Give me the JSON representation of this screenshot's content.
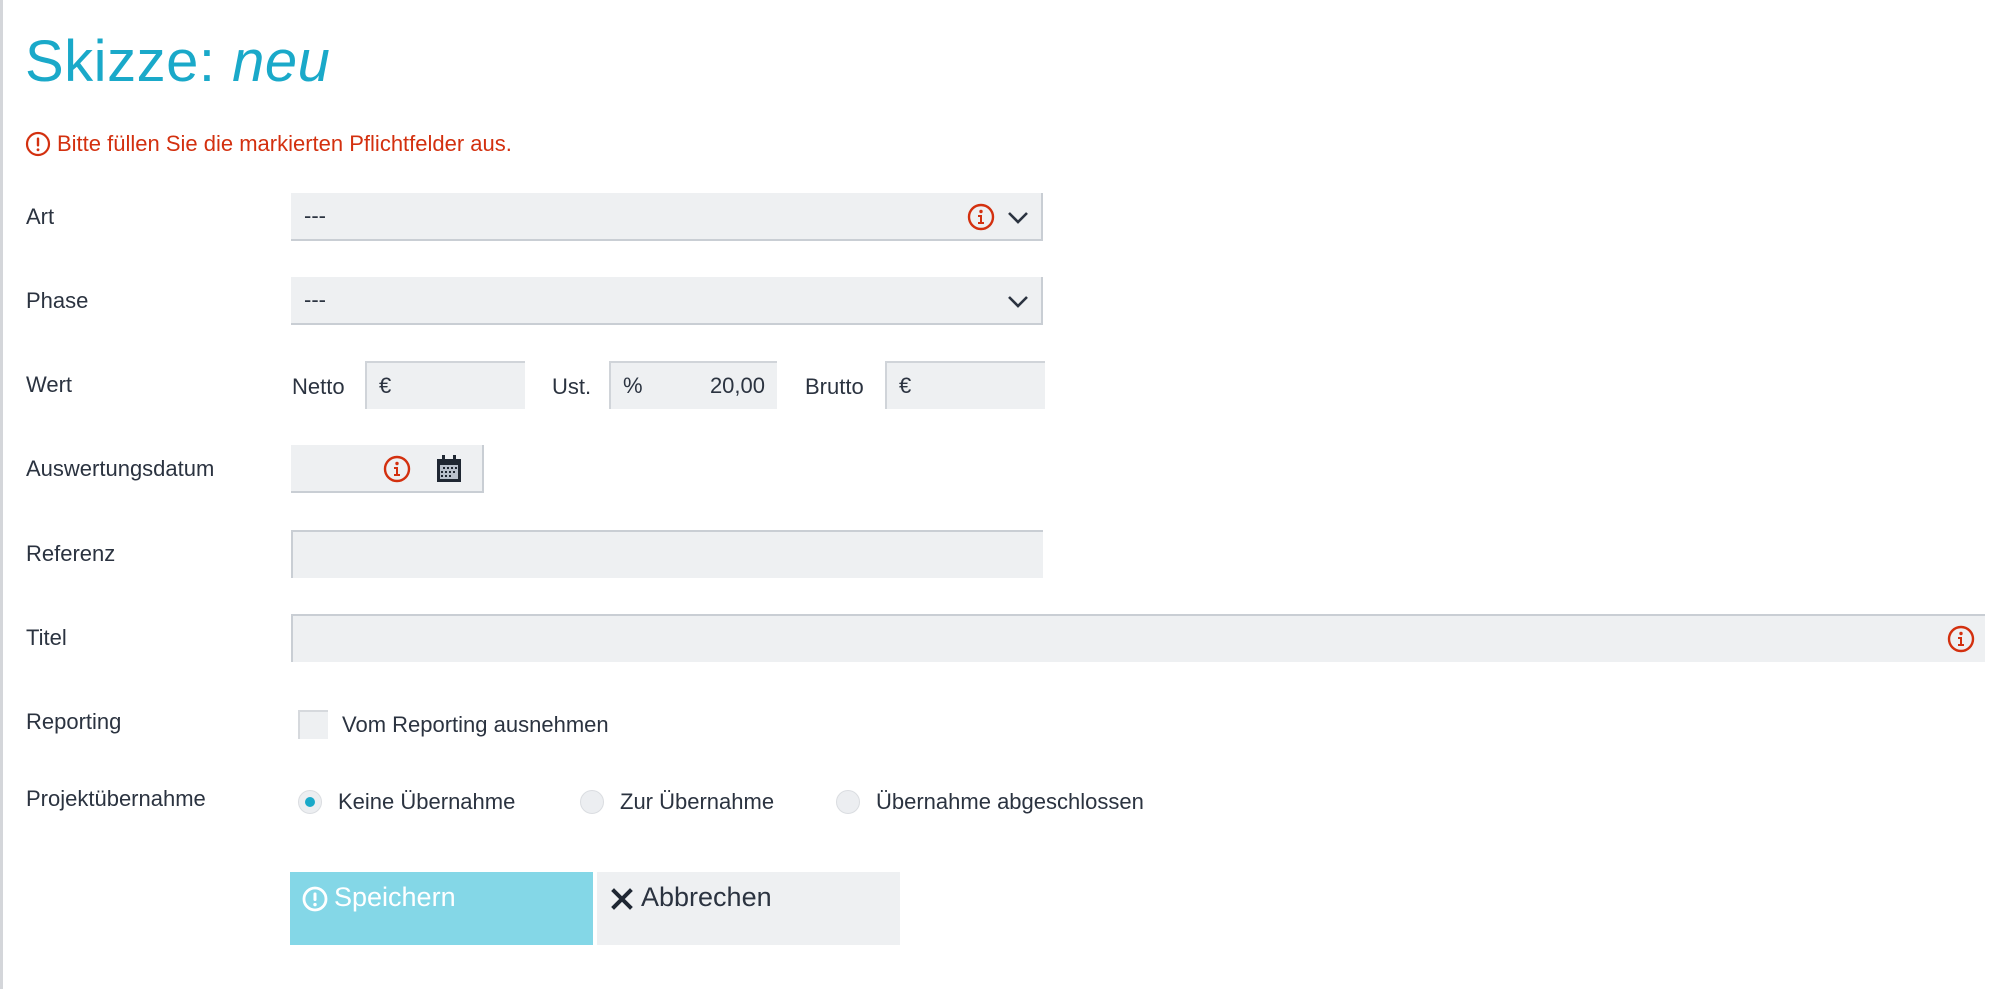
{
  "page": {
    "title_prefix": "Skizze:",
    "title_state": "neu",
    "error_message": "Bitte füllen Sie die markierten Pflichtfelder aus."
  },
  "colors": {
    "accent": "#1aa9c9",
    "error": "#d3300f",
    "field_bg": "#eef0f2",
    "save_button_bg": "#84d7e7"
  },
  "form": {
    "art": {
      "label": "Art",
      "value": "---",
      "required_missing": true,
      "icons": [
        "info-icon",
        "chevron-down-icon"
      ]
    },
    "phase": {
      "label": "Phase",
      "value": "---",
      "icons": [
        "chevron-down-icon"
      ]
    },
    "wert": {
      "label": "Wert",
      "netto": {
        "label": "Netto",
        "unit": "€",
        "value": ""
      },
      "ust": {
        "label": "Ust.",
        "unit": "%",
        "value": "20,00"
      },
      "brutto": {
        "label": "Brutto",
        "unit": "€",
        "value": ""
      }
    },
    "auswertungsdatum": {
      "label": "Auswertungsdatum",
      "value": "",
      "required_missing": true,
      "icons": [
        "info-icon",
        "calendar-icon"
      ]
    },
    "referenz": {
      "label": "Referenz",
      "value": ""
    },
    "titel": {
      "label": "Titel",
      "value": "",
      "required_missing": true,
      "icons": [
        "info-icon"
      ]
    },
    "reporting": {
      "label": "Reporting",
      "checkbox_label": "Vom Reporting ausnehmen",
      "checked": false
    },
    "projektuebernahme": {
      "label": "Projektübernahme",
      "options": [
        {
          "label": "Keine Übernahme",
          "selected": true
        },
        {
          "label": "Zur Übernahme",
          "selected": false
        },
        {
          "label": "Übernahme abgeschlossen",
          "selected": false
        }
      ]
    }
  },
  "buttons": {
    "save": {
      "label": "Speichern",
      "icon": "exclamation-circle-icon"
    },
    "cancel": {
      "label": "Abbrechen",
      "icon": "close-icon"
    }
  }
}
